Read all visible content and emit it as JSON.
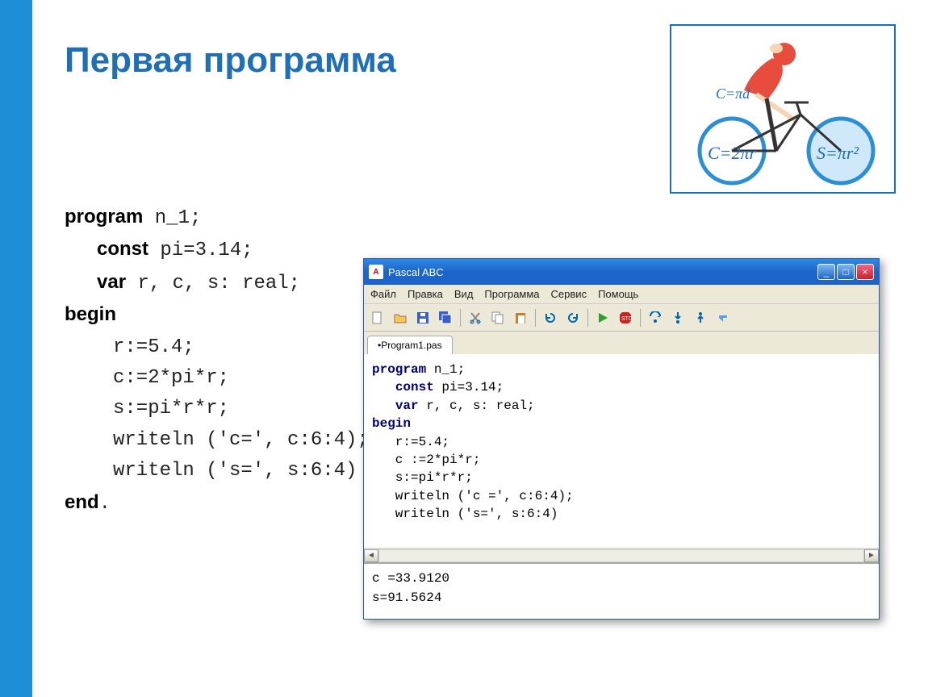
{
  "slide": {
    "title": "Первая программа"
  },
  "code_listing": {
    "l1_kw": "program",
    "l1_rest": " n_1;",
    "l2_kw": "const",
    "l2_rest": " pi=3.14;",
    "l3_kw": "var",
    "l3_rest": " r, c, s: real;",
    "l4_kw": "begin",
    "l5": "r:=5.4;",
    "l6": "c:=2*pi*r;",
    "l7": "s:=pi*r*r;",
    "l8": "writeln ('c=', c:6:4);",
    "l9": "writeln ('s=', s:6:4)",
    "l10_kw": "end",
    "l10_rest": "."
  },
  "illustration": {
    "formula_top": "C=πd",
    "formula_left": "C=2πr",
    "formula_right": "S=πr²"
  },
  "pascal_window": {
    "title": "Pascal ABC",
    "menu": [
      "Файл",
      "Правка",
      "Вид",
      "Программа",
      "Сервис",
      "Помощь"
    ],
    "tab_label": "•Program1.pas",
    "toolbar_icons": [
      "new",
      "open",
      "save",
      "save-all",
      "cut",
      "copy",
      "paste",
      "undo",
      "redo",
      "run",
      "stop",
      "step-over",
      "step-into",
      "step-out",
      "toggle-breakpoint"
    ],
    "editor_lines": [
      {
        "kw": "program",
        "rest": " n_1;"
      },
      {
        "indent": "   ",
        "kw": "const",
        "rest": " pi=3.14;"
      },
      {
        "indent": "   ",
        "kw": "var",
        "rest": " r, c, s: real;"
      },
      {
        "kw": "begin",
        "rest": ""
      },
      {
        "indent": "   ",
        "rest": "r:=5.4;"
      },
      {
        "indent": "   ",
        "rest": "c :=2*pi*r;"
      },
      {
        "indent": "   ",
        "rest": "s:=pi*r*r;"
      },
      {
        "indent": "   ",
        "rest": "writeln ('c =', c:6:4);"
      },
      {
        "indent": "   ",
        "rest": "writeln ('s=', s:6:4)"
      }
    ],
    "output": [
      "c =33.9120",
      "s=91.5624"
    ]
  }
}
